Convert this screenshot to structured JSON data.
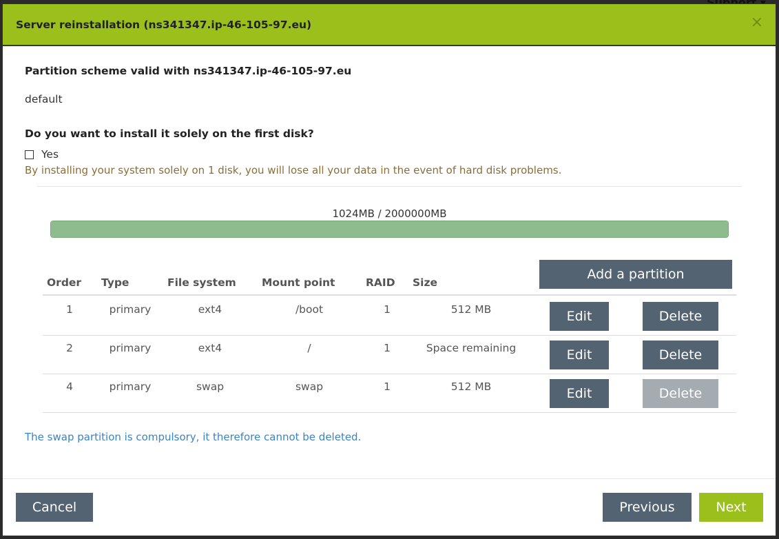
{
  "backdrop": {
    "menu_hint": "Support ▾"
  },
  "modal": {
    "title": "Server reinstallation (ns341347.ip-46-105-97.eu)",
    "close_glyph": "×"
  },
  "scheme": {
    "heading": "Partition scheme valid with ns341347.ip-46-105-97.eu",
    "value": "default"
  },
  "disk": {
    "question": "Do you want to install it solely on the first disk?",
    "checkbox_label": "Yes",
    "checked": false,
    "warning": "By installing your system solely on 1 disk, you will lose all your data in the event of hard disk problems."
  },
  "usage": {
    "text": "1024MB / 2000000MB",
    "used_mb": 1024,
    "total_mb": 2000000,
    "bar_color": "#8fbc8f"
  },
  "table": {
    "add_label": "Add a partition",
    "headers": {
      "order": "Order",
      "type": "Type",
      "fs": "File system",
      "mount": "Mount point",
      "raid": "RAID",
      "size": "Size"
    },
    "rows": [
      {
        "order": "1",
        "type": "primary",
        "fs": "ext4",
        "mount": "/boot",
        "raid": "1",
        "size": "512 MB",
        "edit": "Edit",
        "delete": "Delete",
        "delete_enabled": true
      },
      {
        "order": "2",
        "type": "primary",
        "fs": "ext4",
        "mount": "/",
        "raid": "1",
        "size": "Space remaining",
        "edit": "Edit",
        "delete": "Delete",
        "delete_enabled": true
      },
      {
        "order": "4",
        "type": "primary",
        "fs": "swap",
        "mount": "swap",
        "raid": "1",
        "size": "512 MB",
        "edit": "Edit",
        "delete": "Delete",
        "delete_enabled": false
      }
    ]
  },
  "info": "The swap partition is compulsory, it therefore cannot be deleted.",
  "footer": {
    "cancel": "Cancel",
    "previous": "Previous",
    "next": "Next"
  },
  "colors": {
    "header": "#9bc01c",
    "button": "#536372",
    "button_disabled": "#a4abb1",
    "warning": "#8a6d3b",
    "info": "#3a84c4"
  }
}
